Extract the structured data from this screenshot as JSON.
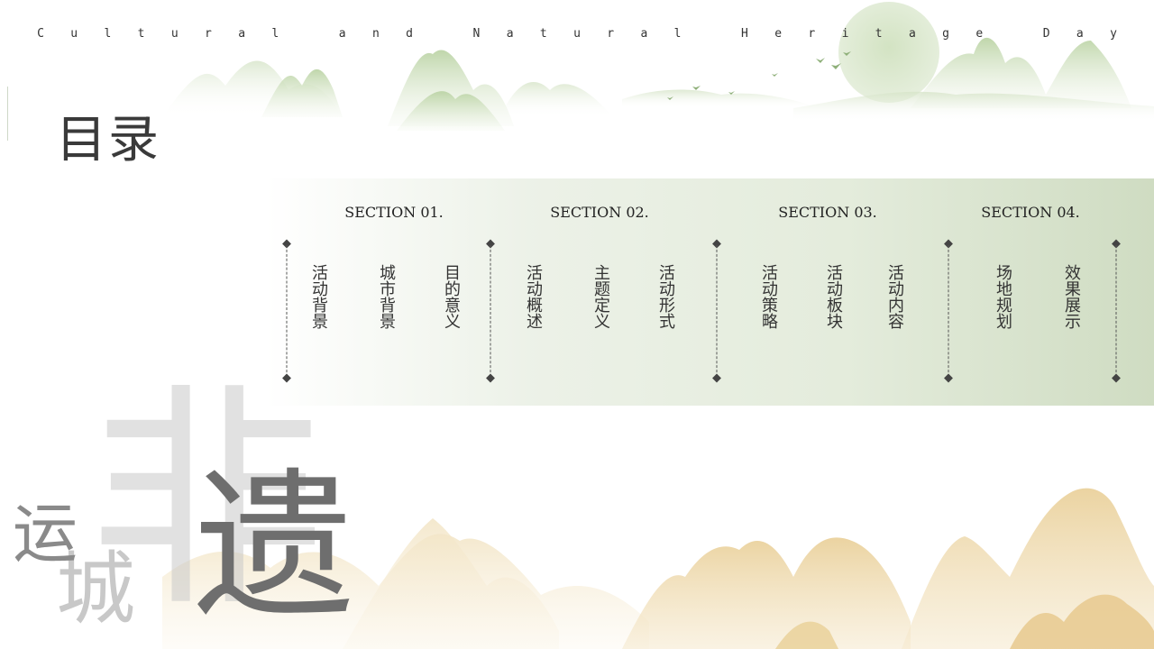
{
  "banner": {
    "text": "Cultural and Natural Heritage Day"
  },
  "title": "目录",
  "sections": [
    {
      "label": "SECTION 01.",
      "items": [
        "活动背景",
        "城市背景",
        "目的意义"
      ]
    },
    {
      "label": "SECTION 02.",
      "items": [
        "活动概述",
        "主题定义",
        "活动形式"
      ]
    },
    {
      "label": "SECTION 03.",
      "items": [
        "活动策略",
        "活动板块",
        "活动内容"
      ]
    },
    {
      "label": "SECTION 04.",
      "items": [
        "场地规划",
        "效果展示"
      ]
    }
  ],
  "decor": {
    "char_fei": "非",
    "char_yi": "遗",
    "char_yun": "运",
    "char_cheng": "城"
  },
  "colors": {
    "green_accent": "#c9dbb7",
    "gold_mountain": "#edd7a4",
    "text_dark": "#333333",
    "band_end": "#cfdcc2"
  }
}
